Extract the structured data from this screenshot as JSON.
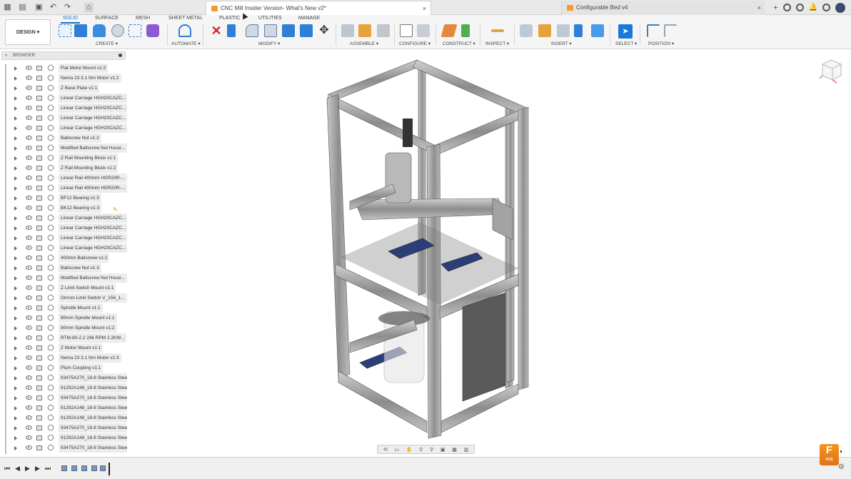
{
  "window": {
    "active_tab_title": "CNC Mill Insider Version- What's New v2*",
    "inactive_tab_title": "Configurable Bed v4",
    "close_glyph": "×",
    "add_tab_glyph": "+"
  },
  "ribbon": {
    "workspace": "DESIGN ▾",
    "tabs": [
      "SOLID",
      "SURFACE",
      "MESH",
      "SHEET METAL",
      "PLASTIC",
      "UTILITIES",
      "MANAGE"
    ],
    "active_tab": "SOLID",
    "groups": {
      "create": "CREATE ▾",
      "automate": "AUTOMATE ▾",
      "modify": "MODIFY ▾",
      "assemble": "ASSEMBLE ▾",
      "configure": "CONFIGURE ▾",
      "construct": "CONSTRUCT ▾",
      "inspect": "INSPECT ▾",
      "insert": "INSERT ▾",
      "select": "SELECT ▾",
      "position": "POSITION ▾"
    }
  },
  "browser": {
    "title": "BROWSER",
    "items": [
      "Flat Motor Mount v1:2",
      "Nema 23 3.1 Nm Motor v1:2",
      "Z Base Plate v1:1",
      "Linear Carriage HGH20CAZC...",
      "Linear Carriage HGH20CAZC...",
      "Linear Carriage HGH20CAZC...",
      "Linear Carriage HGH20CAZC...",
      "Ballscrew Nut v1:2",
      "Modified Ballscrew Nut Housi...",
      "Z Rail Mounting Block v1:1",
      "Z Rail Mounting Block v1:2",
      "Linear Rail 400mm HGR20R-...",
      "Linear Rail 400mm HGR20R-...",
      "BF12 Bearing v1:3",
      "BK12 Bearing v1:3",
      "Linear Carriage HGH20CAZC...",
      "Linear Carriage HGH20CAZC...",
      "Linear Carriage HGH20CAZC...",
      "Linear Carriage HGH20CAZC...",
      "400mm Ballscrew v1:2",
      "Ballscrew Nut v1:3",
      "Modified Ballscrew Nut Housi...",
      "Z Limit Switch Mount v1:1",
      "Omron Limit Switch V_156_1...",
      "Spindle Mount v1:1",
      "80mm Spindle Mount v1:1",
      "80mm Spindle Mount v1:2",
      "RTM-80-2.2 24k RPM 2.2KW...",
      "Z Motor Mount v1:1",
      "Nema 23 3.1 Nm Motor v1:3",
      "Plum Coupling v1:1",
      "93475A270_18-8 Stainless Steel ...",
      "91292A148_18-8 Stainless Steel S...",
      "93475A270_18-8 Stainless Steel ...",
      "91292A148_18-8 Stainless Steel S...",
      "91292A148_18-8 Stainless Steel S...",
      "93475A270_18-8 Stainless Steel ...",
      "91292A148_18-8 Stainless Steel S...",
      "93475A270_18-8 Stainless Steel ..."
    ]
  },
  "badge": {
    "letter": "F",
    "label": "FUS"
  },
  "colors": {
    "accent": "#1b6ec2",
    "frame": "#a9a9a9",
    "fusion_orange": "#f7931e"
  }
}
